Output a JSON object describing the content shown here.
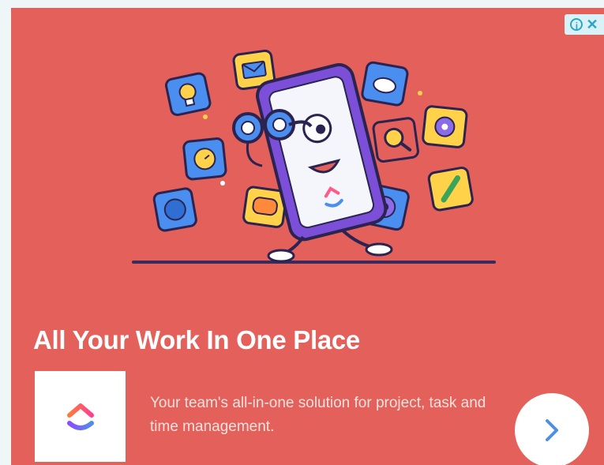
{
  "ad": {
    "headline": "All Your Work In One Place",
    "description": "Your team's all-in-one solution for project, task and time management.",
    "adchoices": {
      "icon": "info-icon",
      "close_icon": "close-icon"
    },
    "next_icon": "chevron-right-icon",
    "logo_icon": "clickup-logo-icon"
  },
  "colors": {
    "background": "#e4605b",
    "accent_blue": "#2aa6c7",
    "chevron": "#4f8fe3"
  }
}
